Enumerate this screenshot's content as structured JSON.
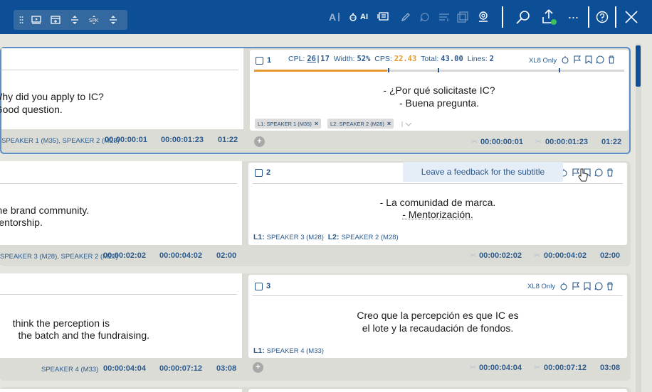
{
  "toolbar": {
    "ai_label": "AI",
    "more_label": "···"
  },
  "rows": [
    {
      "index": "1",
      "source_text": [
        "Why did you apply to IC?",
        "- Good question."
      ],
      "source_speakers": "SPEAKER 1 (M35), SPEAKER 2 (M28)",
      "source_in": "00:00:00:01",
      "source_out": "00:00:01:23",
      "source_dur": "01:22",
      "target_text": [
        "- ¿Por qué solicitaste IC?",
        "- Buena pregunta."
      ],
      "target_in": "00:00:00:01",
      "target_out": "00:00:01:23",
      "target_dur": "01:22",
      "stats": {
        "cpl_label": "CPL:",
        "cpl_value": "26",
        "cpl_max": "17",
        "width_label": "Width:",
        "width_value": "52%",
        "cps_label": "CPS:",
        "cps_value": "22.43",
        "total_label": "Total:",
        "total_value": "43.00",
        "lines_label": "Lines:",
        "lines_value": "2",
        "progress": 0.36
      },
      "xl8_label": "XL8 Only",
      "chips": [
        "L1: SPEAKER 1 (M35)",
        "L2: SPEAKER 2 (M28)"
      ]
    },
    {
      "index": "2",
      "source_text": [
        "The brand community.",
        "- Mentorship."
      ],
      "source_speakers": "SPEAKER 3 (M28), SPEAKER 2 (M28)",
      "source_in": "00:00:02:02",
      "source_out": "00:00:04:02",
      "source_dur": "02:00",
      "target_text": [
        "- La comunidad de marca.",
        "- Mentorización."
      ],
      "target_speaker_l1": "L1:",
      "target_speaker_l1_name": "SPEAKER 3 (M28)",
      "target_speaker_l2": "L2:",
      "target_speaker_l2_name": "SPEAKER 2 (M28)",
      "target_in": "00:00:02:02",
      "target_out": "00:00:04:02",
      "target_dur": "02:00",
      "tooltip": "Leave a feedback for the subtitle"
    },
    {
      "index": "3",
      "source_text": [
        "think the perception is",
        "the batch and the fundraising."
      ],
      "source_speakers": "SPEAKER 4 (M33)",
      "source_in": "00:00:04:04",
      "source_out": "00:00:07:12",
      "source_dur": "03:08",
      "target_text": [
        "Creo que la percepción es que IC es",
        "el lote y la recaudación de fondos."
      ],
      "target_speaker_l1": "L1:",
      "target_speaker_l1_name": "SPEAKER 4 (M33)",
      "target_in": "00:00:04:04",
      "target_out": "00:00:07:12",
      "target_dur": "03:08",
      "xl8_label": "XL8 Only"
    }
  ],
  "colors": {
    "topbar": "#0d4f96",
    "accent_orange": "#e69a2e",
    "text_blue": "#2a5a8d"
  }
}
